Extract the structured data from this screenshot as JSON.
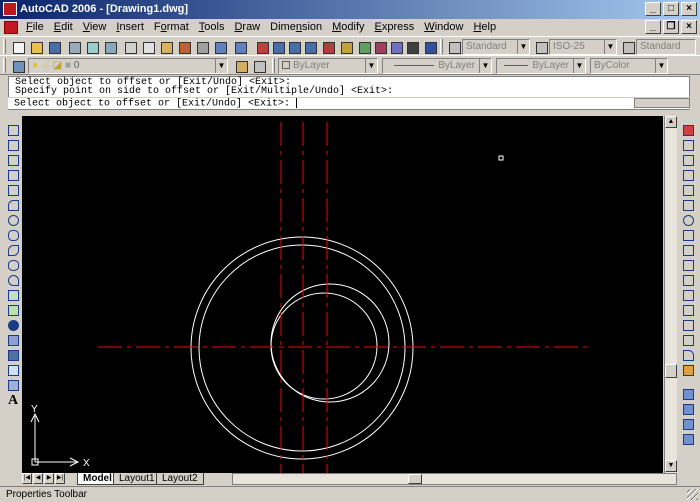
{
  "window": {
    "title": "AutoCAD 2006 - [Drawing1.dwg]"
  },
  "menu": [
    {
      "pre": "",
      "u": "F",
      "post": "ile"
    },
    {
      "pre": "",
      "u": "E",
      "post": "dit"
    },
    {
      "pre": "",
      "u": "V",
      "post": "iew"
    },
    {
      "pre": "",
      "u": "I",
      "post": "nsert"
    },
    {
      "pre": "F",
      "u": "o",
      "post": "rmat"
    },
    {
      "pre": "",
      "u": "T",
      "post": "ools"
    },
    {
      "pre": "",
      "u": "D",
      "post": "raw"
    },
    {
      "pre": "Dime",
      "u": "n",
      "post": "sion"
    },
    {
      "pre": "",
      "u": "M",
      "post": "odify"
    },
    {
      "pre": "",
      "u": "E",
      "post": "xpress"
    },
    {
      "pre": "",
      "u": "W",
      "post": "indow"
    },
    {
      "pre": "",
      "u": "H",
      "post": "elp"
    }
  ],
  "toolbar": {
    "text_style": "Standard",
    "dim_style": "ISO-25",
    "table_style": "Standard",
    "layer": "0",
    "color": "ByLayer",
    "linetype": "ByLayer",
    "lineweight": "ByLayer",
    "plotstyle": "ByColor"
  },
  "command": {
    "history": [
      "Select object to offset or [Exit/Undo] <Exit>:",
      "Specify point on side to offset or [Exit/Multiple/Undo] <Exit>:"
    ],
    "prompt": "Select object to offset or [Exit/Undo] <Exit>:"
  },
  "ucs": {
    "x_label": "X",
    "y_label": "Y"
  },
  "tabs": [
    "Model",
    "Layout1",
    "Layout2"
  ],
  "status": {
    "text": "Properties Toolbar"
  },
  "colors": {
    "centerline": "#e01010",
    "geometry": "#ffffff",
    "background": "#000000"
  }
}
